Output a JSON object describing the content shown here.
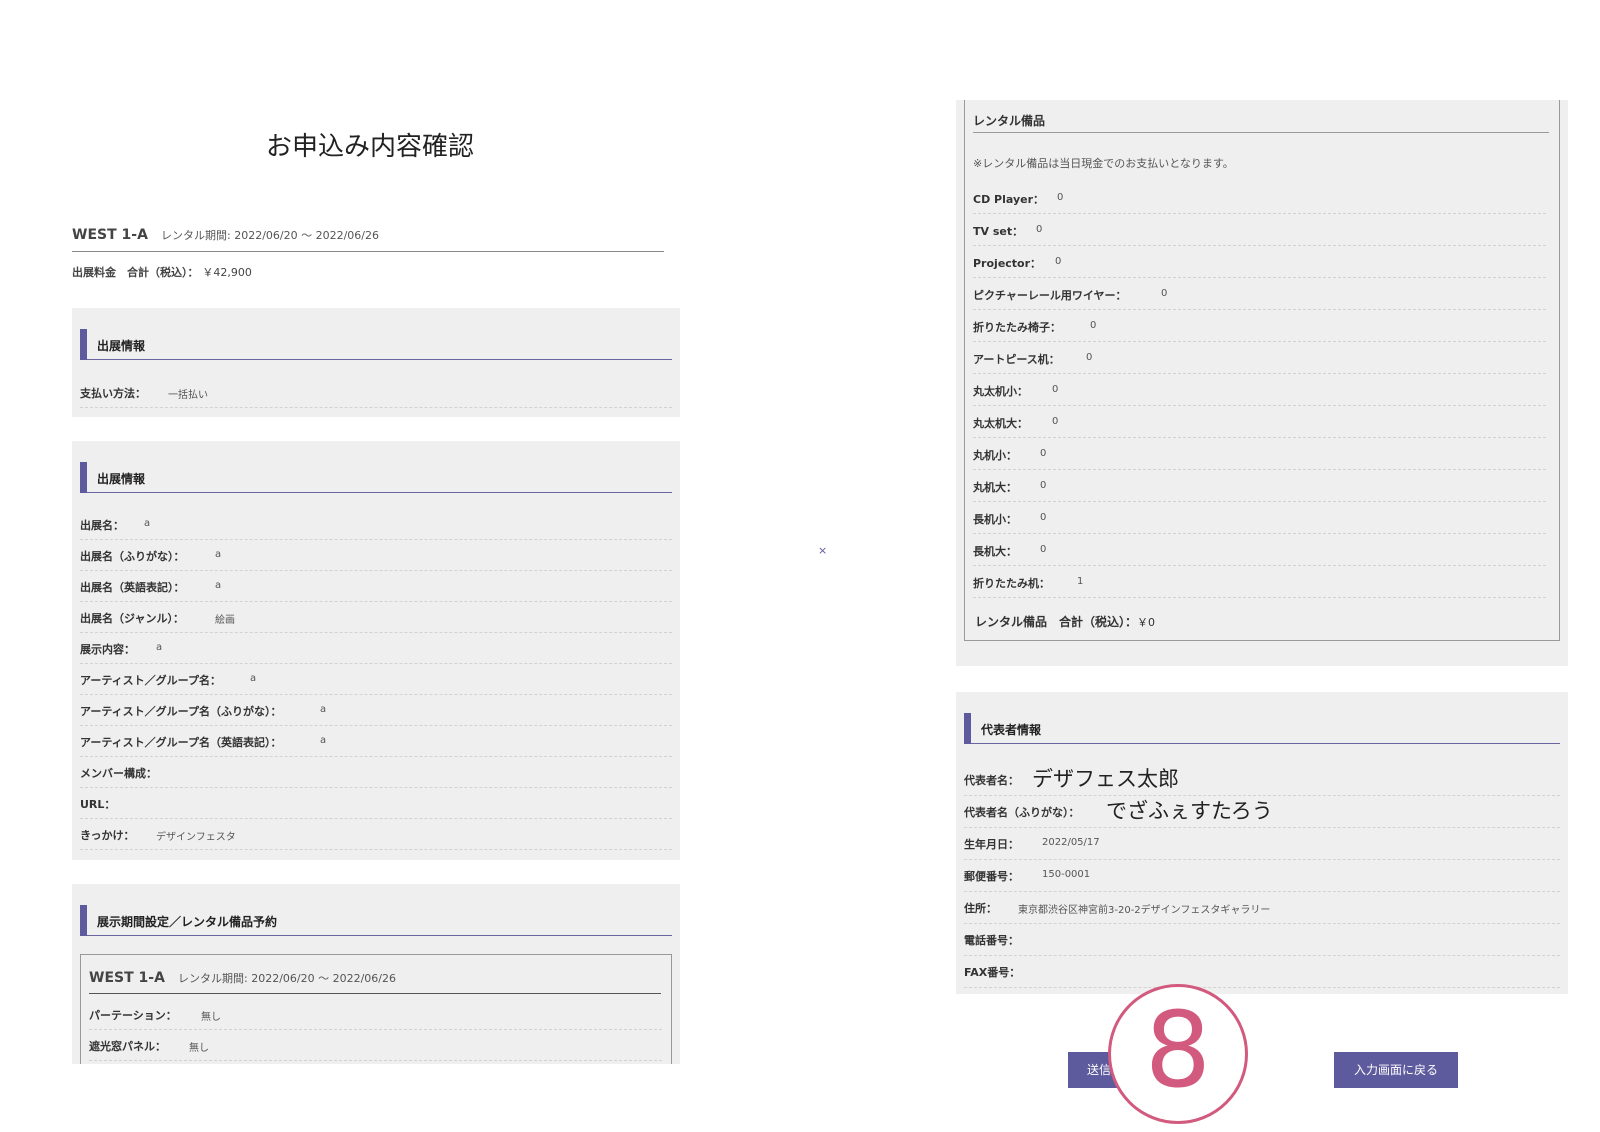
{
  "page_title": "お申込み内容確認",
  "plan": {
    "name": "WEST 1-A",
    "period": "レンタル期間: 2022/06/20 〜 2022/06/26"
  },
  "fee": {
    "label": "出展料金　合計（税込）：",
    "value": "￥42,900"
  },
  "payment_section": {
    "heading": "出展情報",
    "rows": [
      {
        "label": "支払い方法：",
        "value": "一括払い"
      }
    ]
  },
  "exhibit_section": {
    "heading": "出展情報",
    "rows": [
      {
        "label": "出展名：",
        "value": "a"
      },
      {
        "label": "出展名（ふりがな）：",
        "value": "a"
      },
      {
        "label": "出展名（英語表記）：",
        "value": "a"
      },
      {
        "label": "出展名（ジャンル）：",
        "value": "絵画"
      },
      {
        "label": "展示内容：",
        "value": "a"
      },
      {
        "label": "アーティスト／グループ名：",
        "value": "a"
      },
      {
        "label": "アーティスト／グループ名（ふりがな）：",
        "value": "a"
      },
      {
        "label": "アーティスト／グループ名（英語表記）：",
        "value": "a"
      },
      {
        "label": "メンバー構成：",
        "value": ""
      },
      {
        "label": "URL：",
        "value": ""
      },
      {
        "label": "きっかけ：",
        "value": "デザインフェスタ"
      }
    ]
  },
  "period_section": {
    "heading": "展示期間設定／レンタル備品予約",
    "plan_name": "WEST 1-A",
    "plan_period": "レンタル期間: 2022/06/20 〜 2022/06/26",
    "rows": [
      {
        "label": "パーテーション：",
        "value": "無し"
      },
      {
        "label": "遮光窓パネル：",
        "value": "無し"
      }
    ]
  },
  "rental_section": {
    "heading": "レンタル備品",
    "note": "※レンタル備品は当日現金でのお支払いとなります。",
    "items": [
      {
        "label": "CD Player：",
        "value": "0"
      },
      {
        "label": "TV set：",
        "value": "0"
      },
      {
        "label": "Projector：",
        "value": "0"
      },
      {
        "label": "ピクチャーレール用ワイヤー：",
        "value": "0"
      },
      {
        "label": "折りたたみ椅子：",
        "value": "0"
      },
      {
        "label": "アートピース机：",
        "value": "0"
      },
      {
        "label": "丸太机小：",
        "value": "0"
      },
      {
        "label": "丸太机大：",
        "value": "0"
      },
      {
        "label": "丸机小：",
        "value": "0"
      },
      {
        "label": "丸机大：",
        "value": "0"
      },
      {
        "label": "長机小：",
        "value": "0"
      },
      {
        "label": "長机大：",
        "value": "0"
      },
      {
        "label": "折りたたみ机：",
        "value": "1"
      }
    ],
    "total_label": "レンタル備品　合計（税込）：",
    "total_value": "￥0"
  },
  "rep_section": {
    "heading": "代表者情報",
    "name_label": "代表者名：",
    "name_value": "デザフェス太郎",
    "kana_label": "代表者名（ふりがな）：",
    "kana_value": "でざふぇすたろう",
    "rows": [
      {
        "label": "生年月日：",
        "value": "2022/05/17"
      },
      {
        "label": "郵便番号：",
        "value": "150-0001"
      },
      {
        "label": "住所：",
        "value": "東京都渋谷区神宮前3-20-2デザインフェスタギャラリー"
      },
      {
        "label": "電話番号：",
        "value": ""
      },
      {
        "label": "FAX番号：",
        "value": ""
      }
    ]
  },
  "buttons": {
    "submit": "送信",
    "back": "入力画面に戻る"
  },
  "step_badge": "8",
  "close_mark": "×"
}
